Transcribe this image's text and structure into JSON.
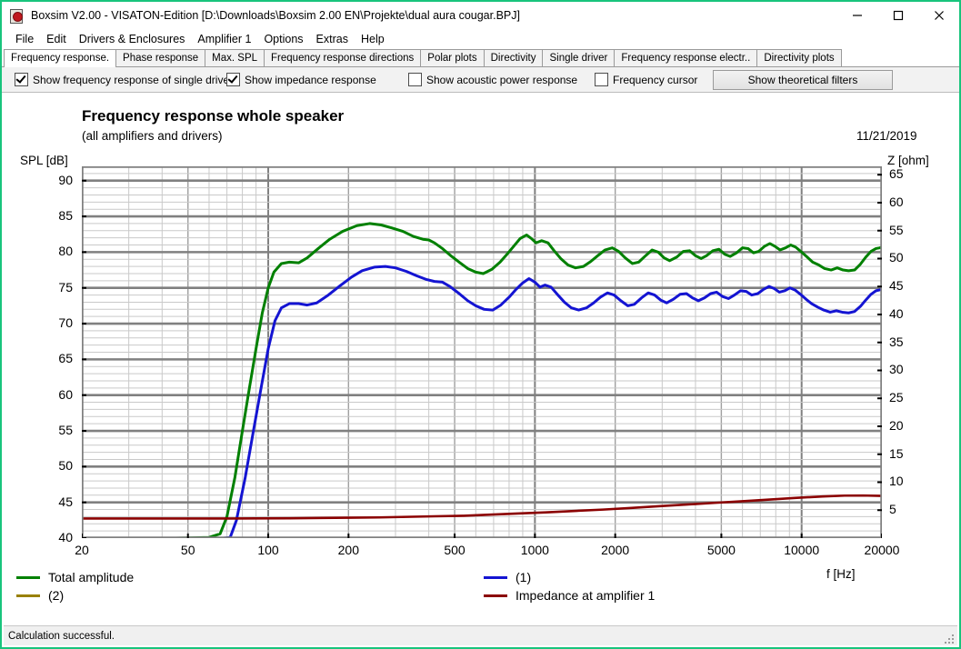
{
  "window": {
    "title": "Boxsim V2.00 - VISATON-Edition [D:\\Downloads\\Boxsim 2.00 EN\\Projekte\\dual aura cougar.BPJ]",
    "icon": "boxsim-app-icon",
    "minimize": "minimize-icon",
    "maximize": "maximize-icon",
    "close": "close-icon",
    "border_color": "#18c47c"
  },
  "menu": {
    "items": [
      {
        "label": "File"
      },
      {
        "label": "Edit"
      },
      {
        "label": "Drivers & Enclosures"
      },
      {
        "label": "Amplifier 1"
      },
      {
        "label": "Options"
      },
      {
        "label": "Extras"
      },
      {
        "label": "Help"
      }
    ]
  },
  "tabs": [
    {
      "label": "Frequency response.",
      "active": true
    },
    {
      "label": "Phase response",
      "active": false
    },
    {
      "label": "Max. SPL",
      "active": false
    },
    {
      "label": "Frequency response directions",
      "active": false
    },
    {
      "label": "Polar plots",
      "active": false
    },
    {
      "label": "Directivity",
      "active": false
    },
    {
      "label": "Single driver",
      "active": false
    },
    {
      "label": "Frequency response electr..",
      "active": false
    },
    {
      "label": "Directivity plots",
      "active": false
    }
  ],
  "options": {
    "show_single_driver": {
      "label": "Show frequency response of single driver",
      "checked": true
    },
    "show_impedance": {
      "label": "Show impedance response",
      "checked": true
    },
    "show_acoustic_power": {
      "label": "Show acoustic power response",
      "checked": false
    },
    "frequency_cursor": {
      "label": "Frequency cursor",
      "checked": false
    },
    "theoretical_filters_button": "Show theoretical filters"
  },
  "chart_data": {
    "type": "line",
    "title": "Frequency response whole speaker",
    "subtitle": "(all amplifiers and drivers)",
    "date": "11/21/2019",
    "xlabel": "f [Hz]",
    "ylabel_left": "SPL [dB]",
    "ylabel_right": "Z [ohm]",
    "xscale": "log",
    "xlim": [
      20,
      20000
    ],
    "ylim_left": [
      40,
      92
    ],
    "ylim_right": [
      0,
      66.5
    ],
    "grid": true,
    "xticks": [
      20,
      50,
      100,
      200,
      500,
      1000,
      2000,
      5000,
      10000,
      20000
    ],
    "xtick_labels": [
      "20",
      "50",
      "100",
      "200",
      "500",
      "1000",
      "2000",
      "5000",
      "10000",
      "20000"
    ],
    "yticks_left": [
      90,
      85,
      80,
      75,
      70,
      65,
      60,
      55,
      50,
      45,
      40
    ],
    "yticks_right": [
      65,
      60,
      55,
      50,
      45,
      40,
      35,
      30,
      25,
      20,
      15,
      10,
      5
    ],
    "ytick_major_step_left": 5,
    "ytick_minor_step_left": 1,
    "legend_position": "below-plot",
    "series": [
      {
        "name": "Total amplitude",
        "color": "#008000",
        "axis": "left",
        "points": [
          [
            20,
            40.0
          ],
          [
            30,
            40.0
          ],
          [
            45,
            40.0
          ],
          [
            60,
            40.1
          ],
          [
            66,
            40.6
          ],
          [
            70,
            43.0
          ],
          [
            75,
            48.5
          ],
          [
            80,
            55.0
          ],
          [
            85,
            61.0
          ],
          [
            90,
            66.5
          ],
          [
            95,
            71.5
          ],
          [
            100,
            75.0
          ],
          [
            105,
            77.2
          ],
          [
            112,
            78.4
          ],
          [
            120,
            78.6
          ],
          [
            130,
            78.5
          ],
          [
            140,
            79.2
          ],
          [
            155,
            80.6
          ],
          [
            170,
            81.8
          ],
          [
            190,
            82.9
          ],
          [
            215,
            83.7
          ],
          [
            240,
            84.0
          ],
          [
            265,
            83.8
          ],
          [
            290,
            83.4
          ],
          [
            320,
            82.9
          ],
          [
            350,
            82.2
          ],
          [
            380,
            81.8
          ],
          [
            400,
            81.7
          ],
          [
            420,
            81.3
          ],
          [
            450,
            80.5
          ],
          [
            480,
            79.6
          ],
          [
            520,
            78.6
          ],
          [
            560,
            77.7
          ],
          [
            600,
            77.2
          ],
          [
            640,
            77.0
          ],
          [
            690,
            77.6
          ],
          [
            740,
            78.6
          ],
          [
            790,
            79.8
          ],
          [
            840,
            81.0
          ],
          [
            880,
            81.9
          ],
          [
            930,
            82.4
          ],
          [
            970,
            81.9
          ],
          [
            1010,
            81.3
          ],
          [
            1060,
            81.6
          ],
          [
            1120,
            81.3
          ],
          [
            1180,
            80.2
          ],
          [
            1250,
            79.1
          ],
          [
            1330,
            78.2
          ],
          [
            1420,
            77.8
          ],
          [
            1520,
            78.0
          ],
          [
            1620,
            78.7
          ],
          [
            1720,
            79.5
          ],
          [
            1830,
            80.3
          ],
          [
            1950,
            80.6
          ],
          [
            2060,
            80.1
          ],
          [
            2180,
            79.2
          ],
          [
            2320,
            78.4
          ],
          [
            2450,
            78.6
          ],
          [
            2600,
            79.5
          ],
          [
            2750,
            80.3
          ],
          [
            2900,
            80.0
          ],
          [
            3050,
            79.2
          ],
          [
            3200,
            78.8
          ],
          [
            3400,
            79.3
          ],
          [
            3600,
            80.1
          ],
          [
            3800,
            80.2
          ],
          [
            4000,
            79.5
          ],
          [
            4200,
            79.1
          ],
          [
            4400,
            79.5
          ],
          [
            4650,
            80.2
          ],
          [
            4900,
            80.4
          ],
          [
            5150,
            79.7
          ],
          [
            5400,
            79.4
          ],
          [
            5700,
            79.9
          ],
          [
            6000,
            80.6
          ],
          [
            6300,
            80.5
          ],
          [
            6600,
            79.9
          ],
          [
            6900,
            80.1
          ],
          [
            7250,
            80.8
          ],
          [
            7600,
            81.2
          ],
          [
            7950,
            80.8
          ],
          [
            8300,
            80.3
          ],
          [
            8700,
            80.6
          ],
          [
            9100,
            81.0
          ],
          [
            9500,
            80.7
          ],
          [
            10000,
            80.0
          ],
          [
            10500,
            79.3
          ],
          [
            11000,
            78.6
          ],
          [
            11600,
            78.2
          ],
          [
            12200,
            77.7
          ],
          [
            12900,
            77.5
          ],
          [
            13600,
            77.8
          ],
          [
            14300,
            77.5
          ],
          [
            15000,
            77.4
          ],
          [
            15800,
            77.5
          ],
          [
            16600,
            78.3
          ],
          [
            17400,
            79.3
          ],
          [
            18200,
            80.1
          ],
          [
            19000,
            80.5
          ],
          [
            19600,
            80.6
          ],
          [
            20000,
            80.7
          ]
        ]
      },
      {
        "name": "(1)",
        "color": "#1414d2",
        "axis": "left",
        "points": [
          [
            20,
            40.0
          ],
          [
            40,
            40.0
          ],
          [
            60,
            40.0
          ],
          [
            68,
            40.0
          ],
          [
            72,
            40.1
          ],
          [
            76,
            42.5
          ],
          [
            82,
            48.5
          ],
          [
            88,
            55.0
          ],
          [
            94,
            61.0
          ],
          [
            100,
            66.5
          ],
          [
            106,
            70.4
          ],
          [
            112,
            72.2
          ],
          [
            120,
            72.8
          ],
          [
            130,
            72.8
          ],
          [
            140,
            72.6
          ],
          [
            152,
            72.9
          ],
          [
            168,
            74.0
          ],
          [
            186,
            75.3
          ],
          [
            205,
            76.5
          ],
          [
            225,
            77.4
          ],
          [
            250,
            77.9
          ],
          [
            275,
            78.0
          ],
          [
            300,
            77.8
          ],
          [
            330,
            77.3
          ],
          [
            360,
            76.7
          ],
          [
            390,
            76.2
          ],
          [
            420,
            75.9
          ],
          [
            450,
            75.8
          ],
          [
            480,
            75.2
          ],
          [
            520,
            74.2
          ],
          [
            560,
            73.2
          ],
          [
            600,
            72.5
          ],
          [
            645,
            72.0
          ],
          [
            695,
            71.9
          ],
          [
            745,
            72.6
          ],
          [
            800,
            73.7
          ],
          [
            850,
            74.8
          ],
          [
            900,
            75.7
          ],
          [
            950,
            76.3
          ],
          [
            1000,
            75.8
          ],
          [
            1045,
            75.1
          ],
          [
            1090,
            75.4
          ],
          [
            1150,
            75.1
          ],
          [
            1220,
            74.0
          ],
          [
            1290,
            73.0
          ],
          [
            1370,
            72.2
          ],
          [
            1460,
            71.9
          ],
          [
            1560,
            72.2
          ],
          [
            1660,
            72.9
          ],
          [
            1760,
            73.7
          ],
          [
            1870,
            74.3
          ],
          [
            1980,
            74.0
          ],
          [
            2100,
            73.2
          ],
          [
            2230,
            72.5
          ],
          [
            2360,
            72.7
          ],
          [
            2510,
            73.6
          ],
          [
            2660,
            74.3
          ],
          [
            2810,
            74.0
          ],
          [
            2960,
            73.3
          ],
          [
            3120,
            72.9
          ],
          [
            3300,
            73.4
          ],
          [
            3500,
            74.1
          ],
          [
            3700,
            74.2
          ],
          [
            3900,
            73.6
          ],
          [
            4100,
            73.2
          ],
          [
            4320,
            73.6
          ],
          [
            4560,
            74.2
          ],
          [
            4800,
            74.4
          ],
          [
            5050,
            73.8
          ],
          [
            5320,
            73.5
          ],
          [
            5600,
            74.0
          ],
          [
            5900,
            74.6
          ],
          [
            6200,
            74.5
          ],
          [
            6500,
            74.0
          ],
          [
            6850,
            74.2
          ],
          [
            7200,
            74.8
          ],
          [
            7550,
            75.2
          ],
          [
            7900,
            74.9
          ],
          [
            8250,
            74.4
          ],
          [
            8650,
            74.6
          ],
          [
            9050,
            75.0
          ],
          [
            9450,
            74.7
          ],
          [
            9900,
            74.1
          ],
          [
            10400,
            73.4
          ],
          [
            10900,
            72.8
          ],
          [
            11500,
            72.3
          ],
          [
            12100,
            71.9
          ],
          [
            12800,
            71.6
          ],
          [
            13500,
            71.8
          ],
          [
            14200,
            71.6
          ],
          [
            15000,
            71.5
          ],
          [
            15800,
            71.7
          ],
          [
            16600,
            72.4
          ],
          [
            17400,
            73.3
          ],
          [
            18200,
            74.1
          ],
          [
            19000,
            74.6
          ],
          [
            20000,
            74.8
          ]
        ]
      },
      {
        "name": "(2)",
        "color": "#998000",
        "axis": "left",
        "points": []
      },
      {
        "name": "Impedance at amplifier 1",
        "color": "#8b0000",
        "axis": "right",
        "points": [
          [
            20,
            3.5
          ],
          [
            40,
            3.5
          ],
          [
            60,
            3.5
          ],
          [
            90,
            3.52
          ],
          [
            120,
            3.55
          ],
          [
            160,
            3.6
          ],
          [
            200,
            3.65
          ],
          [
            260,
            3.7
          ],
          [
            330,
            3.8
          ],
          [
            420,
            3.9
          ],
          [
            540,
            4.0
          ],
          [
            680,
            4.2
          ],
          [
            860,
            4.4
          ],
          [
            1100,
            4.6
          ],
          [
            1400,
            4.85
          ],
          [
            1800,
            5.1
          ],
          [
            2300,
            5.4
          ],
          [
            2900,
            5.7
          ],
          [
            3700,
            6.0
          ],
          [
            4700,
            6.3
          ],
          [
            6000,
            6.6
          ],
          [
            7600,
            6.9
          ],
          [
            9600,
            7.2
          ],
          [
            12000,
            7.45
          ],
          [
            14500,
            7.6
          ],
          [
            17000,
            7.62
          ],
          [
            20000,
            7.55
          ]
        ]
      }
    ]
  },
  "legend_entries": [
    {
      "label": "Total amplitude",
      "color": "#008000"
    },
    {
      "label": "(2)",
      "color": "#998000"
    },
    {
      "label": "(1)",
      "color": "#1414d2"
    },
    {
      "label": "Impedance at amplifier 1",
      "color": "#8b0000"
    }
  ],
  "statusbar": {
    "message": "Calculation successful."
  }
}
